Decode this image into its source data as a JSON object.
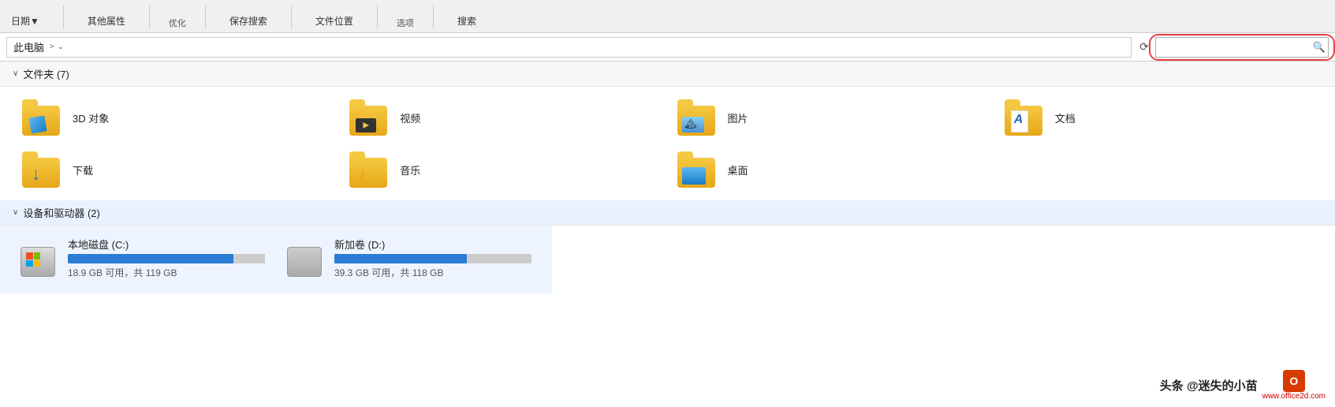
{
  "toolbar": {
    "group1_label": "优化",
    "group2_label": "选项",
    "btn_date": "日期▼",
    "btn_other_attrs": "其他属性",
    "btn_save_search": "保存搜索",
    "btn_file_location": "文件位置",
    "btn_search": "搜索"
  },
  "address_bar": {
    "path": "此电脑",
    "separator": ">",
    "search_placeholder": ""
  },
  "folders_section": {
    "title": "文件夹 (7)",
    "chevron": "∨",
    "items": [
      {
        "name": "3D 对象",
        "type": "3d"
      },
      {
        "name": "视频",
        "type": "video"
      },
      {
        "name": "图片",
        "type": "picture"
      },
      {
        "name": "文档",
        "type": "document"
      },
      {
        "name": "下载",
        "type": "download"
      },
      {
        "name": "音乐",
        "type": "music"
      },
      {
        "name": "桌面",
        "type": "desktop"
      }
    ]
  },
  "devices_section": {
    "title": "设备和驱动器 (2)",
    "chevron": "∨",
    "items": [
      {
        "name": "本地磁盘 (C:)",
        "free": "18.9 GB 可用，共 119 GB",
        "fill_pct": 84,
        "type": "windows"
      },
      {
        "name": "新加卷 (D:)",
        "free": "39.3 GB 可用，共 118 GB",
        "fill_pct": 67,
        "type": "plain"
      }
    ]
  },
  "watermark": {
    "text": "头条 @迷失的小苗",
    "site": "www.office2d.com"
  }
}
